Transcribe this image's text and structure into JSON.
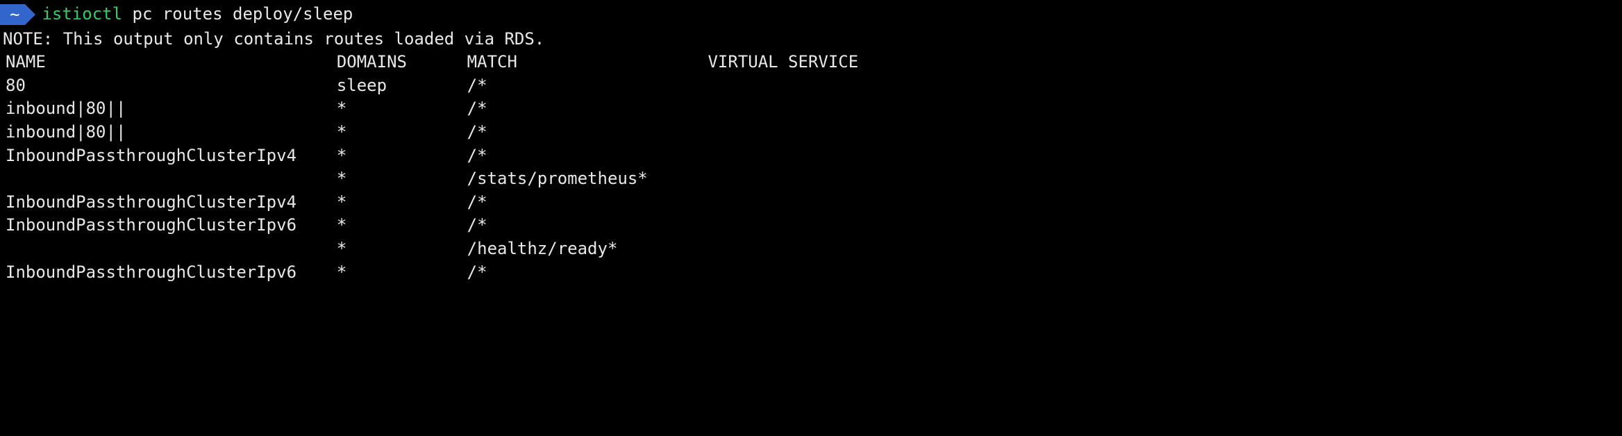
{
  "prompt": {
    "cwd_symbol": "~",
    "command_name": "istioctl",
    "command_args": "pc routes deploy/sleep"
  },
  "output": {
    "note": "NOTE: This output only contains routes loaded via RDS.",
    "headers": {
      "name": "NAME",
      "domains": "DOMAINS",
      "match": "MATCH",
      "virtual_service": "VIRTUAL SERVICE"
    },
    "rows": [
      {
        "name": "80",
        "domains": "sleep",
        "match": "/*",
        "virtual_service": ""
      },
      {
        "name": "inbound|80||",
        "domains": "*",
        "match": "/*",
        "virtual_service": ""
      },
      {
        "name": "inbound|80||",
        "domains": "*",
        "match": "/*",
        "virtual_service": ""
      },
      {
        "name": "InboundPassthroughClusterIpv4",
        "domains": "*",
        "match": "/*",
        "virtual_service": ""
      },
      {
        "name": "",
        "domains": "*",
        "match": "/stats/prometheus*",
        "virtual_service": ""
      },
      {
        "name": "InboundPassthroughClusterIpv4",
        "domains": "*",
        "match": "/*",
        "virtual_service": ""
      },
      {
        "name": "InboundPassthroughClusterIpv6",
        "domains": "*",
        "match": "/*",
        "virtual_service": ""
      },
      {
        "name": "",
        "domains": "*",
        "match": "/healthz/ready*",
        "virtual_service": ""
      },
      {
        "name": "InboundPassthroughClusterIpv6",
        "domains": "*",
        "match": "/*",
        "virtual_service": ""
      }
    ],
    "col_widths": {
      "name": 33,
      "domains": 13,
      "match": 24,
      "virtual_service": 20
    }
  }
}
